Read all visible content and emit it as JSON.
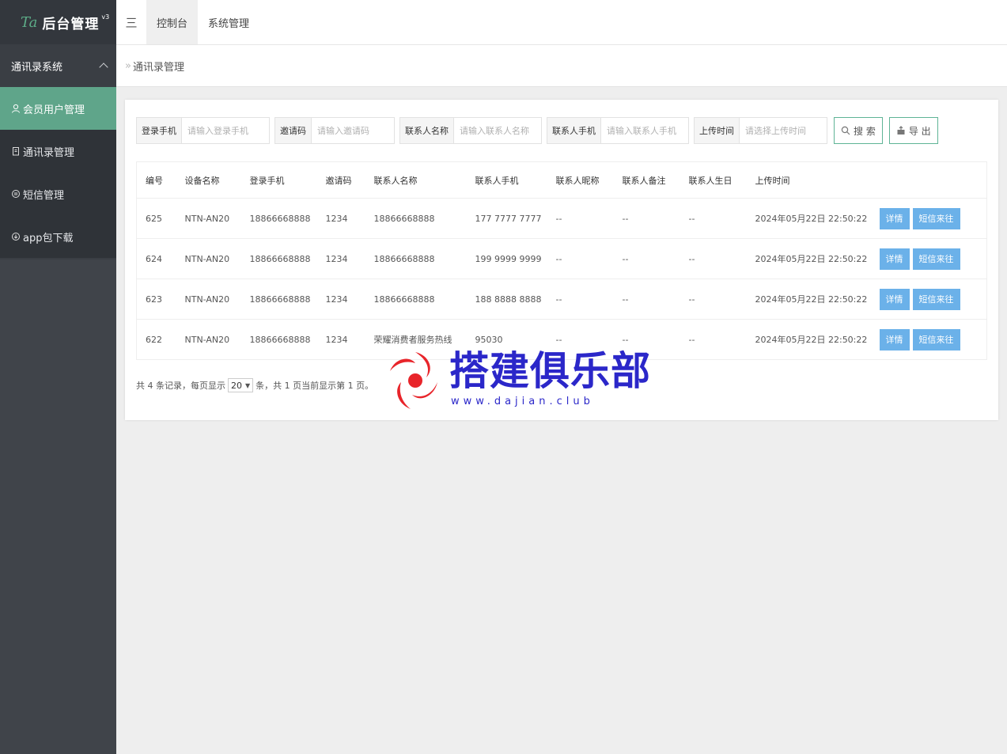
{
  "sidebar": {
    "logo_mark": "Ta",
    "title": "后台管理",
    "version": "v3",
    "group_label": "通讯录系统",
    "items": [
      {
        "label": "会员用户管理",
        "active": true
      },
      {
        "label": "通讯录管理",
        "active": false
      },
      {
        "label": "短信管理",
        "active": false
      },
      {
        "label": "app包下载",
        "active": false
      }
    ]
  },
  "topbar": {
    "toggle_glyph": "三",
    "tabs": [
      {
        "label": "控制台",
        "active": true
      },
      {
        "label": "系统管理",
        "active": false
      }
    ]
  },
  "breadcrumb": {
    "arrow": "»",
    "label": "通讯录管理"
  },
  "filters": {
    "login_phone": {
      "label": "登录手机",
      "placeholder": "请输入登录手机"
    },
    "invite_code": {
      "label": "邀请码",
      "placeholder": "请输入邀请码"
    },
    "contact_name": {
      "label": "联系人名称",
      "placeholder": "请输入联系人名称"
    },
    "contact_phone": {
      "label": "联系人手机",
      "placeholder": "请输入联系人手机"
    },
    "upload_time": {
      "label": "上传时间",
      "placeholder": "请选择上传时间"
    },
    "search_label": "搜 索",
    "export_label": "导 出"
  },
  "table": {
    "columns": [
      "编号",
      "设备名称",
      "登录手机",
      "邀请码",
      "联系人名称",
      "联系人手机",
      "联系人昵称",
      "联系人备注",
      "联系人生日",
      "上传时间",
      ""
    ],
    "detail_label": "详情",
    "sms_label": "短信来往",
    "rows": [
      {
        "id": "625",
        "device": "NTN-AN20",
        "login_phone": "18866668888",
        "invite": "1234",
        "contact_name": "18866668888",
        "contact_phone": "177 7777 7777",
        "nickname": "--",
        "remark": "--",
        "birthday": "--",
        "upload_time": "2024年05月22日 22:50:22"
      },
      {
        "id": "624",
        "device": "NTN-AN20",
        "login_phone": "18866668888",
        "invite": "1234",
        "contact_name": "18866668888",
        "contact_phone": "199 9999 9999",
        "nickname": "--",
        "remark": "--",
        "birthday": "--",
        "upload_time": "2024年05月22日 22:50:22"
      },
      {
        "id": "623",
        "device": "NTN-AN20",
        "login_phone": "18866668888",
        "invite": "1234",
        "contact_name": "18866668888",
        "contact_phone": "188 8888 8888",
        "nickname": "--",
        "remark": "--",
        "birthday": "--",
        "upload_time": "2024年05月22日 22:50:22"
      },
      {
        "id": "622",
        "device": "NTN-AN20",
        "login_phone": "18866668888",
        "invite": "1234",
        "contact_name": "荣耀消费者服务热线",
        "contact_phone": "95030",
        "nickname": "--",
        "remark": "--",
        "birthday": "--",
        "upload_time": "2024年05月22日 22:50:22"
      }
    ]
  },
  "pager": {
    "prefix": "共 4 条记录，每页显示",
    "page_size": "20",
    "suffix": "条，共 1 页当前显示第 1 页。"
  },
  "watermark": {
    "text": "搭建俱乐部",
    "url": "www.dajian.club"
  },
  "colors": {
    "sidebar_bg": "#3a3e44",
    "active_item": "#5fa58a",
    "action_button": "#6bb1e9",
    "watermark_text": "#2b27c9",
    "watermark_logo": "#e8242a"
  }
}
